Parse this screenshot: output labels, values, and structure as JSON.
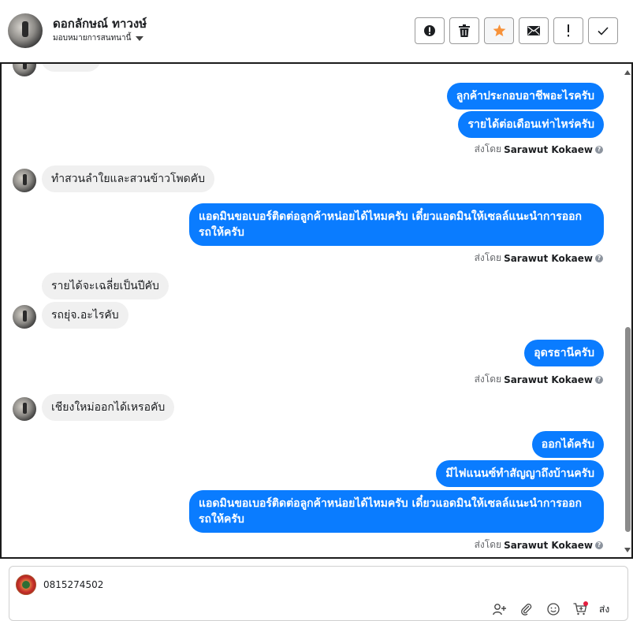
{
  "header": {
    "contact_name": "ดอกลักษณ์ ทาวงษ์",
    "assign_label": "มอบหมายการสนทนานี้",
    "actions": [
      {
        "name": "mark-spam-button",
        "icon": "alert-circle-icon"
      },
      {
        "name": "delete-button",
        "icon": "trash-icon"
      },
      {
        "name": "star-button",
        "icon": "star-icon"
      },
      {
        "name": "mark-unread-button",
        "icon": "envelope-icon"
      },
      {
        "name": "follow-up-button",
        "icon": "exclamation-icon"
      },
      {
        "name": "done-button",
        "icon": "check-icon"
      }
    ],
    "star_color": "#f7923a"
  },
  "messages": {
    "m1": "ลูกค้าประกอบอาชีพอะไรครับ",
    "m2": "รายได้ต่อเดือนเท่าไหร่ครับ",
    "m3": "ทำสวนลำใยและสวนข้าวโพดคับ",
    "m4": "แอดมินขอเบอร์ติดต่อลูกค้าหน่อยได้ไหมครับ เดี๋ยวแอดมินให้เซลล์แนะนำการออกรถให้ครับ",
    "m5": "รายได้จะเฉลี่ยเป็นปีคับ",
    "m6": "รถยุ่จ.อะไรคับ",
    "m7": "อุดรธานีครับ",
    "m8": "เชียงใหม่ออกได้เหรอคับ",
    "m9": "ออกได้ครับ",
    "m10": "มีไฟแนนซ์ทำสัญญาถึงบ้านครับ",
    "m11": "แอดมินขอเบอร์ติดต่อลูกค้าหน่อยได้ไหมครับ เดี๋ยวแอดมินให้เซลล์แนะนำการออกรถให้ครับ"
  },
  "sent_by": {
    "prefix": "ส่งโดย",
    "agent": "Sarawut Kokaew"
  },
  "composer": {
    "text": "0815274502",
    "send_label": "ส่ง"
  },
  "colors": {
    "outgoing_bubble": "#0a7cff",
    "incoming_bubble": "#f0f0f0"
  }
}
